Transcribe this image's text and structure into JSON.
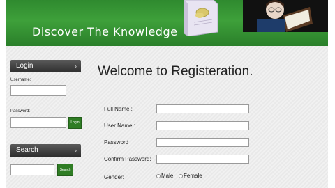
{
  "banner": {
    "tagline": "Discover The Knowledge",
    "book_icon": "book-with-butterfly",
    "photo_icon": "child-reading-book"
  },
  "sidebar": {
    "login": {
      "header": "Login",
      "username_label": "Username:",
      "password_label": "Password:",
      "button_label": "Login"
    },
    "search": {
      "header": "Search",
      "button_label": "Search"
    }
  },
  "main": {
    "heading": "Welcome to Registeration.",
    "fields": {
      "full_name": "Full Name :",
      "user_name": "User Name :",
      "password": "Password :",
      "confirm_password": "Confirm Password:",
      "gender": "Gender:"
    },
    "gender_options": [
      "Male",
      "Female"
    ]
  },
  "colors": {
    "banner_green": "#3ea03a",
    "button_green": "#2f7d24",
    "sidebar_header": "#3a3a3a"
  }
}
